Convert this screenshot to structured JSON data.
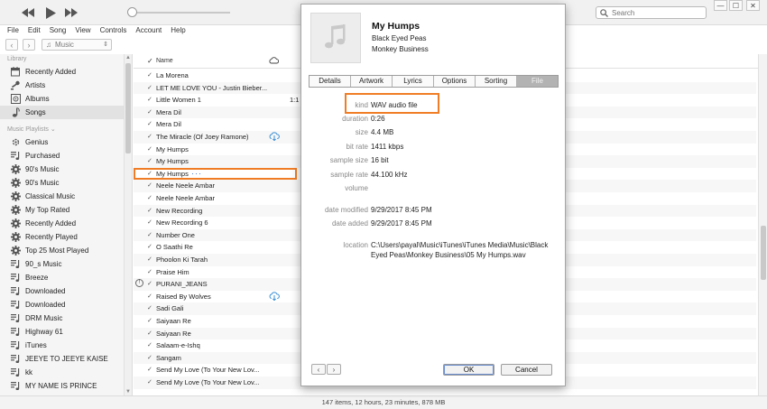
{
  "toolbar": {
    "search_placeholder": "Search"
  },
  "window_controls": [
    "—",
    "☐",
    "✕"
  ],
  "menu": [
    "File",
    "Edit",
    "Song",
    "View",
    "Controls",
    "Account",
    "Help"
  ],
  "nav": {
    "source": "Music"
  },
  "sidebar": {
    "library_header": "Library",
    "library": [
      {
        "label": "Recently Added",
        "icon": "recently-added-icon"
      },
      {
        "label": "Artists",
        "icon": "artists-icon"
      },
      {
        "label": "Albums",
        "icon": "albums-icon"
      },
      {
        "label": "Songs",
        "icon": "songs-icon",
        "selected": true
      }
    ],
    "playlists_header": "Music Playlists",
    "playlists": [
      {
        "label": "Genius",
        "icon": "genius-icon"
      },
      {
        "label": "Purchased",
        "icon": "playlist-icon"
      },
      {
        "label": "90's Music",
        "icon": "smart-playlist-gear-icon"
      },
      {
        "label": "90's Music",
        "icon": "smart-playlist-gear-icon"
      },
      {
        "label": "Classical Music",
        "icon": "smart-playlist-gear-icon"
      },
      {
        "label": "My Top Rated",
        "icon": "smart-playlist-gear-icon"
      },
      {
        "label": "Recently Added",
        "icon": "smart-playlist-gear-icon"
      },
      {
        "label": "Recently Played",
        "icon": "smart-playlist-gear-icon"
      },
      {
        "label": "Top 25 Most Played",
        "icon": "smart-playlist-gear-icon"
      },
      {
        "label": "90_s Music",
        "icon": "playlist-icon"
      },
      {
        "label": "Breeze",
        "icon": "playlist-icon"
      },
      {
        "label": "Downloaded",
        "icon": "playlist-icon"
      },
      {
        "label": "Downloaded",
        "icon": "playlist-icon"
      },
      {
        "label": "DRM Music",
        "icon": "playlist-icon"
      },
      {
        "label": "Highway 61",
        "icon": "playlist-icon"
      },
      {
        "label": "iTunes",
        "icon": "playlist-icon"
      },
      {
        "label": "JEEYE TO JEEYE KAISE",
        "icon": "playlist-icon"
      },
      {
        "label": "kk",
        "icon": "playlist-icon"
      },
      {
        "label": "MY NAME IS PRINCE",
        "icon": "playlist-icon"
      }
    ]
  },
  "songlist": {
    "header_name": "Name",
    "rows": [
      {
        "name": "La Morena"
      },
      {
        "name": "LET ME LOVE YOU - Justin Bieber..."
      },
      {
        "name": "Little Women 1",
        "time": "1:1"
      },
      {
        "name": "Mera Dil"
      },
      {
        "name": "Mera Dil"
      },
      {
        "name": "The Miracle (Of Joey Ramone)",
        "cloud": true
      },
      {
        "name": "My Humps"
      },
      {
        "name": "My Humps"
      },
      {
        "name": "My Humps",
        "highlight": true,
        "dots": "···"
      },
      {
        "name": "Neele Neele Ambar"
      },
      {
        "name": "Neele Neele Ambar"
      },
      {
        "name": "New Recording"
      },
      {
        "name": "New Recording 6"
      },
      {
        "name": "Number One"
      },
      {
        "name": "O Saathi  Re"
      },
      {
        "name": "Phoolon Ki Tarah"
      },
      {
        "name": "Praise Him"
      },
      {
        "name": "PURANI_JEANS",
        "status": "!"
      },
      {
        "name": "Raised By Wolves",
        "cloud": true
      },
      {
        "name": "Sadi Gali"
      },
      {
        "name": "Saiyaan Re"
      },
      {
        "name": "Saiyaan Re"
      },
      {
        "name": "Salaam-e-Ishq"
      },
      {
        "name": "Sangam"
      },
      {
        "name": "Send My Love (To Your New Lov..."
      },
      {
        "name": "Send My Love (To Your New Lov..."
      }
    ]
  },
  "statusbar": "147 items, 12 hours, 23 minutes, 878 MB",
  "dialog": {
    "title": "My Humps",
    "artist": "Black Eyed Peas",
    "album": "Monkey Business",
    "tabs": [
      "Details",
      "Artwork",
      "Lyrics",
      "Options",
      "Sorting",
      "File"
    ],
    "active_tab": "File",
    "fields": [
      {
        "label": "kind",
        "value": "WAV audio file"
      },
      {
        "label": "duration",
        "value": "0:26"
      },
      {
        "label": "size",
        "value": "4.4 MB"
      },
      {
        "label": "bit rate",
        "value": "1411 kbps"
      },
      {
        "label": "sample size",
        "value": "16 bit"
      },
      {
        "label": "sample rate",
        "value": "44.100 kHz"
      },
      {
        "label": "volume",
        "value": ""
      },
      {
        "label": "date modified",
        "value": "9/29/2017 8:45 PM"
      },
      {
        "label": "date added",
        "value": "9/29/2017 8:45 PM"
      },
      {
        "label": "location",
        "value": "C:\\Users\\payal\\Music\\iTunes\\iTunes Media\\Music\\Black",
        "value2": "Eyed Peas\\Monkey Business\\05 My Humps.wav"
      }
    ],
    "ok_label": "OK",
    "cancel_label": "Cancel"
  },
  "colors": {
    "highlight_outline": "#f07d26",
    "cloud_icon": "#3a8fd6",
    "dots": "#3a6ed8"
  }
}
